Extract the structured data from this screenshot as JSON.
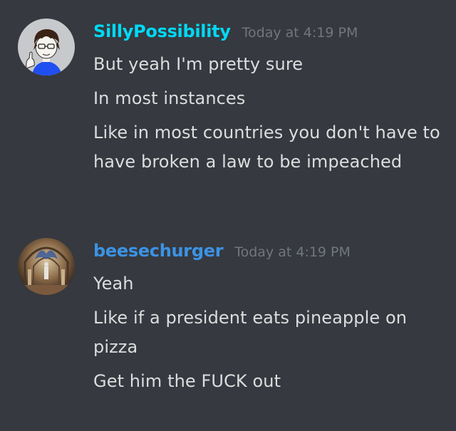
{
  "messages": [
    {
      "username": "SillyPossibility",
      "username_color": "#00d9f5",
      "timestamp": "Today at 4:19 PM",
      "lines": [
        "But yeah I'm pretty sure",
        "In most instances",
        "Like in most countries you don't have to have broken a law to be impeached"
      ]
    },
    {
      "username": "beesechurger",
      "username_color": "#3b93e5",
      "timestamp": "Today at 4:19 PM",
      "lines": [
        "Yeah",
        "Like if a president eats pineapple on pizza",
        "Get him the FUCK out"
      ]
    }
  ]
}
